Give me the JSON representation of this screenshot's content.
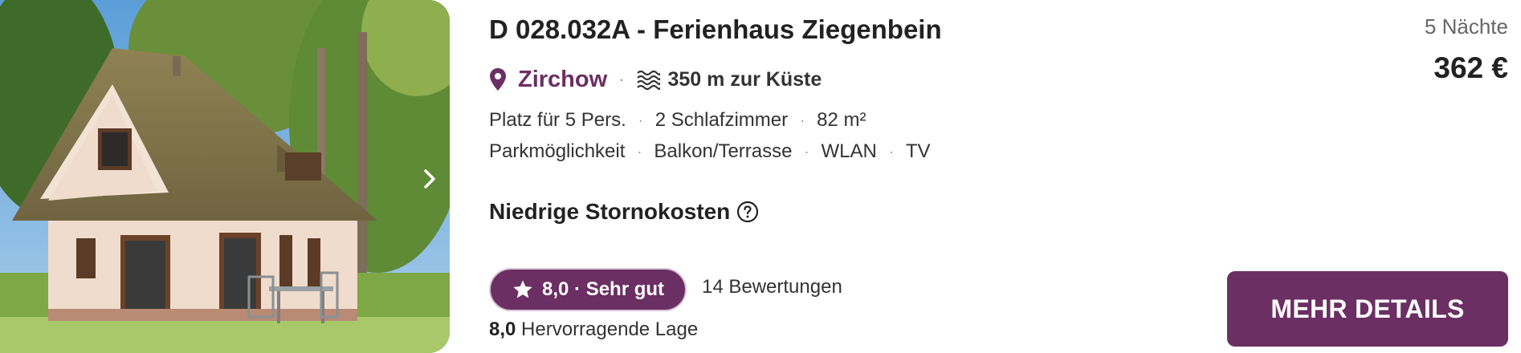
{
  "listing": {
    "title": "D 028.032A - Ferienhaus Ziegenbein",
    "location": "Zirchow",
    "coast_distance": "350 m zur Küste",
    "features_row1": [
      "Platz für 5 Pers.",
      "2 Schlafzimmer",
      "82 m²"
    ],
    "features_row2": [
      "Parkmöglichkeit",
      "Balkon/Terrasse",
      "WLAN",
      "TV"
    ],
    "cancellation": "Niedrige Stornokosten",
    "rating": "8,0 · Sehr gut",
    "reviews": "14 Bewertungen",
    "location_score_value": "8,0",
    "location_score_label": "Hervorragende Lage"
  },
  "pricing": {
    "nights": "5 Nächte",
    "price": "362 €"
  },
  "actions": {
    "details_label": "MEHR DETAILS"
  },
  "icons": {
    "location": "map-pin-icon",
    "coast": "waves-icon",
    "help": "question-circle-icon",
    "rating": "star-icon",
    "next": "chevron-right-icon"
  },
  "colors": {
    "brand": "#6b2f63",
    "text": "#222222",
    "muted": "#666666"
  }
}
